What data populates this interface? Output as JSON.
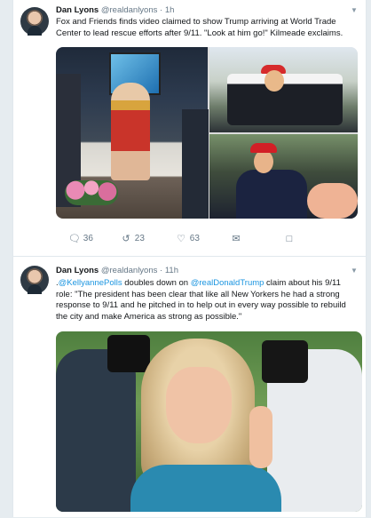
{
  "tweets": [
    {
      "author_name": "Dan Lyons",
      "author_handle": "@realdanlyons",
      "dot": "·",
      "time": "1h",
      "text": "Fox and Friends finds video claimed to show Trump arriving at World Trade Center to lead rescue efforts after 9/11. \"Look at him go!\" Kilmeade exclaims.",
      "actions": {
        "reply_count": "36",
        "retweet_count": "23",
        "like_count": "63"
      }
    },
    {
      "author_name": "Dan Lyons",
      "author_handle": "@realdanlyons",
      "dot": "·",
      "time": "11h",
      "text_prefix": ".",
      "mention1": "@KellyannePolls",
      "text_mid": " doubles down on ",
      "mention2": "@realDonaldTrump",
      "text_rest": " claim about his 9/11 role: \"The president has been clear that like all New Yorkers he had a strong response to 9/11 and he pitched in to help out in every way possible to rebuild the city and make America as strong as possible.\""
    }
  ],
  "icons": {
    "reply": "reply-icon",
    "retweet": "retweet-icon",
    "like": "heart-icon",
    "mail": "envelope-icon",
    "dm": "direct-message-icon",
    "caret": "chevron-down-icon"
  },
  "colors": {
    "link": "#1b95e0",
    "secondary_text": "#657786",
    "background": "#e6ecf0"
  }
}
